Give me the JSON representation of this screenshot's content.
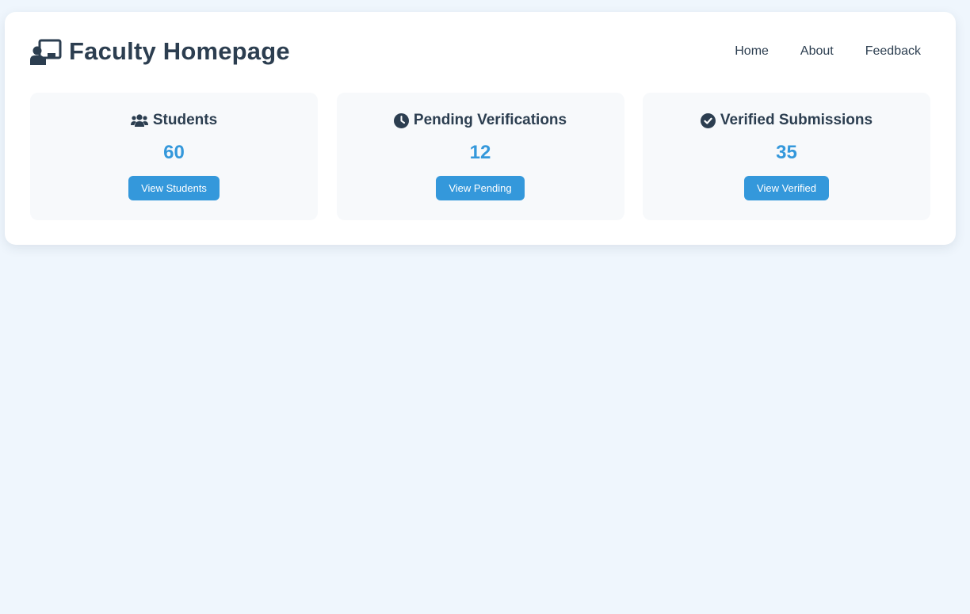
{
  "header": {
    "title": "Faculty Homepage",
    "icon": "chalkboard-teacher-icon"
  },
  "nav": {
    "items": [
      {
        "label": "Home"
      },
      {
        "label": "About"
      },
      {
        "label": "Feedback"
      }
    ]
  },
  "cards": [
    {
      "title": "Students",
      "value": "60",
      "button": "View Students",
      "icon": "users-icon"
    },
    {
      "title": "Pending Verifications",
      "value": "12",
      "button": "View Pending",
      "icon": "clock-icon"
    },
    {
      "title": "Verified Submissions",
      "value": "35",
      "button": "View Verified",
      "icon": "check-circle-icon"
    }
  ],
  "colors": {
    "background": "#eff6fd",
    "panel": "#ffffff",
    "card": "#f7f9fb",
    "text": "#2c3e50",
    "accent": "#3498db"
  }
}
